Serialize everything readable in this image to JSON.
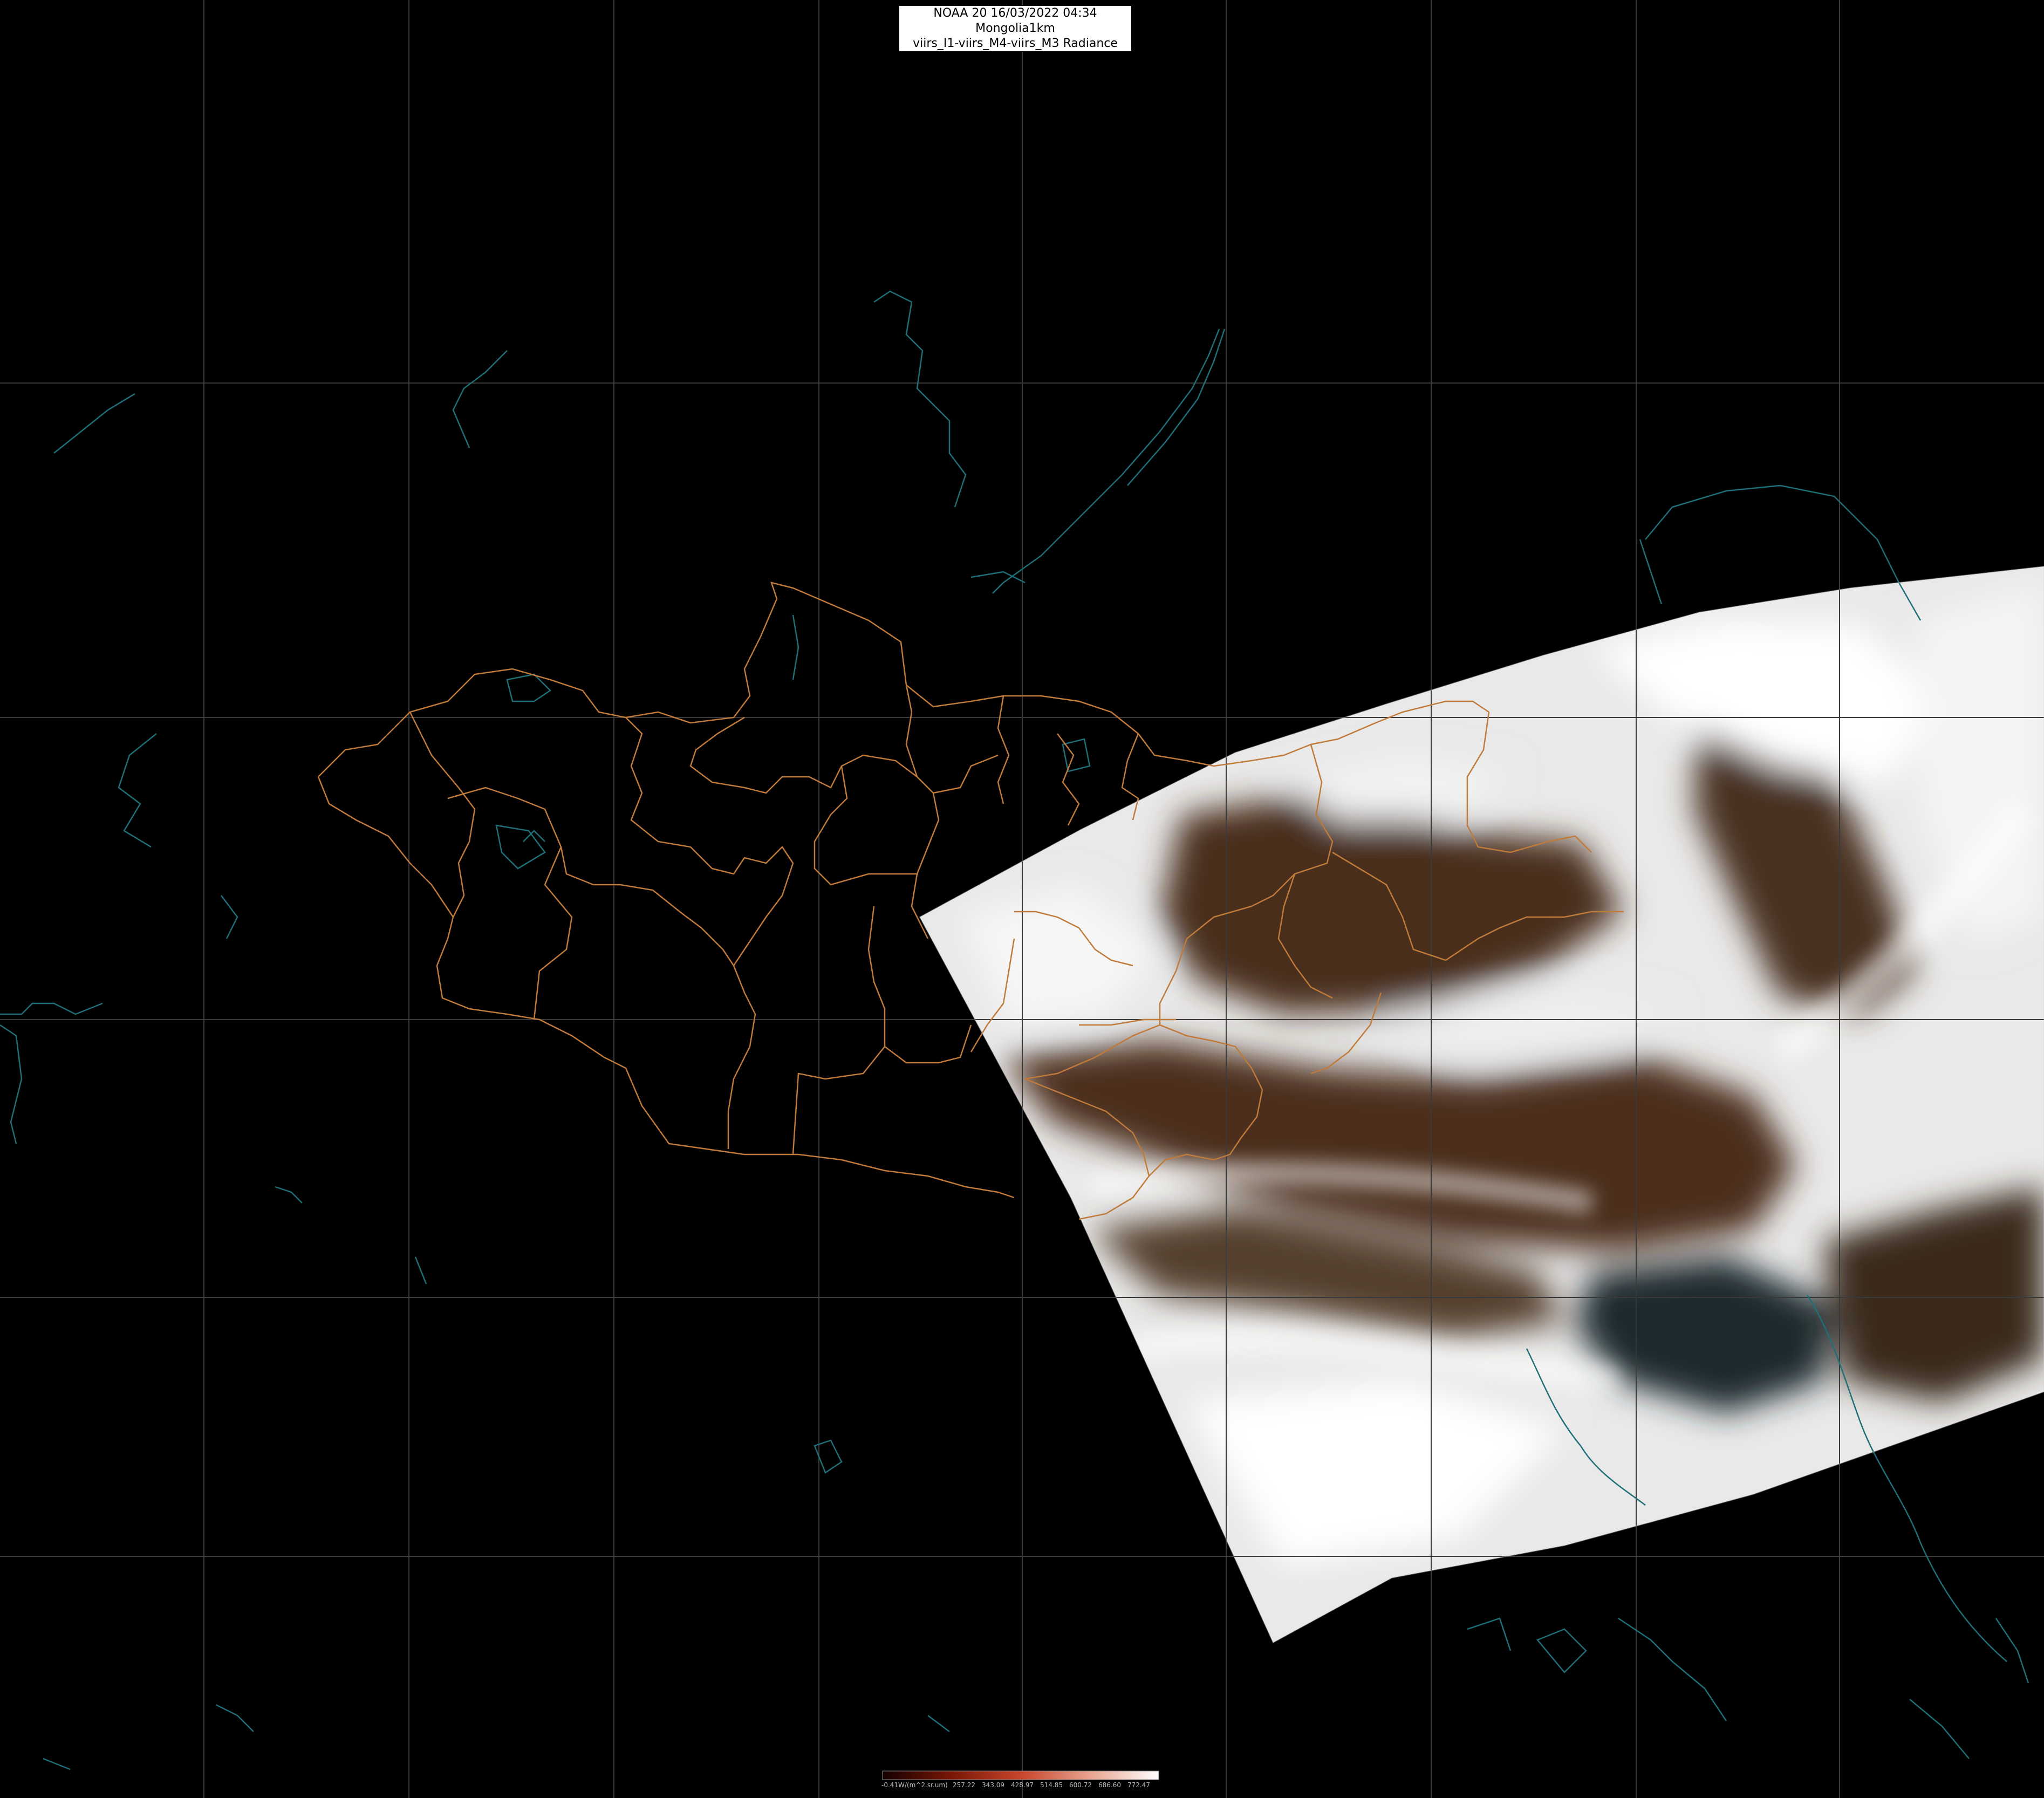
{
  "header": {
    "line1": "NOAA 20 16/03/2022 04:34 Mongolia1km",
    "line2": "viirs_I1-viirs_M4-viirs_M3 Radiance"
  },
  "colorbar": {
    "unit_label": "-0.41W/(m^2.sr.um)",
    "ticks": [
      "257.22",
      "343.09",
      "428.97",
      "514.85",
      "600.72",
      "686.60",
      "772.47"
    ],
    "colors": [
      "#140000",
      "#7a1606",
      "#c8452a",
      "#e8a38f",
      "#ffffff"
    ]
  },
  "map_style": {
    "background": "#000000",
    "grid_color": "#3a3a3a",
    "coast_color": "#1f6f78",
    "border_color": "#c07a3a",
    "cloud_color": "#f2f2f2",
    "land_color": "#4a2e1c",
    "sea_color": "#16252a"
  }
}
